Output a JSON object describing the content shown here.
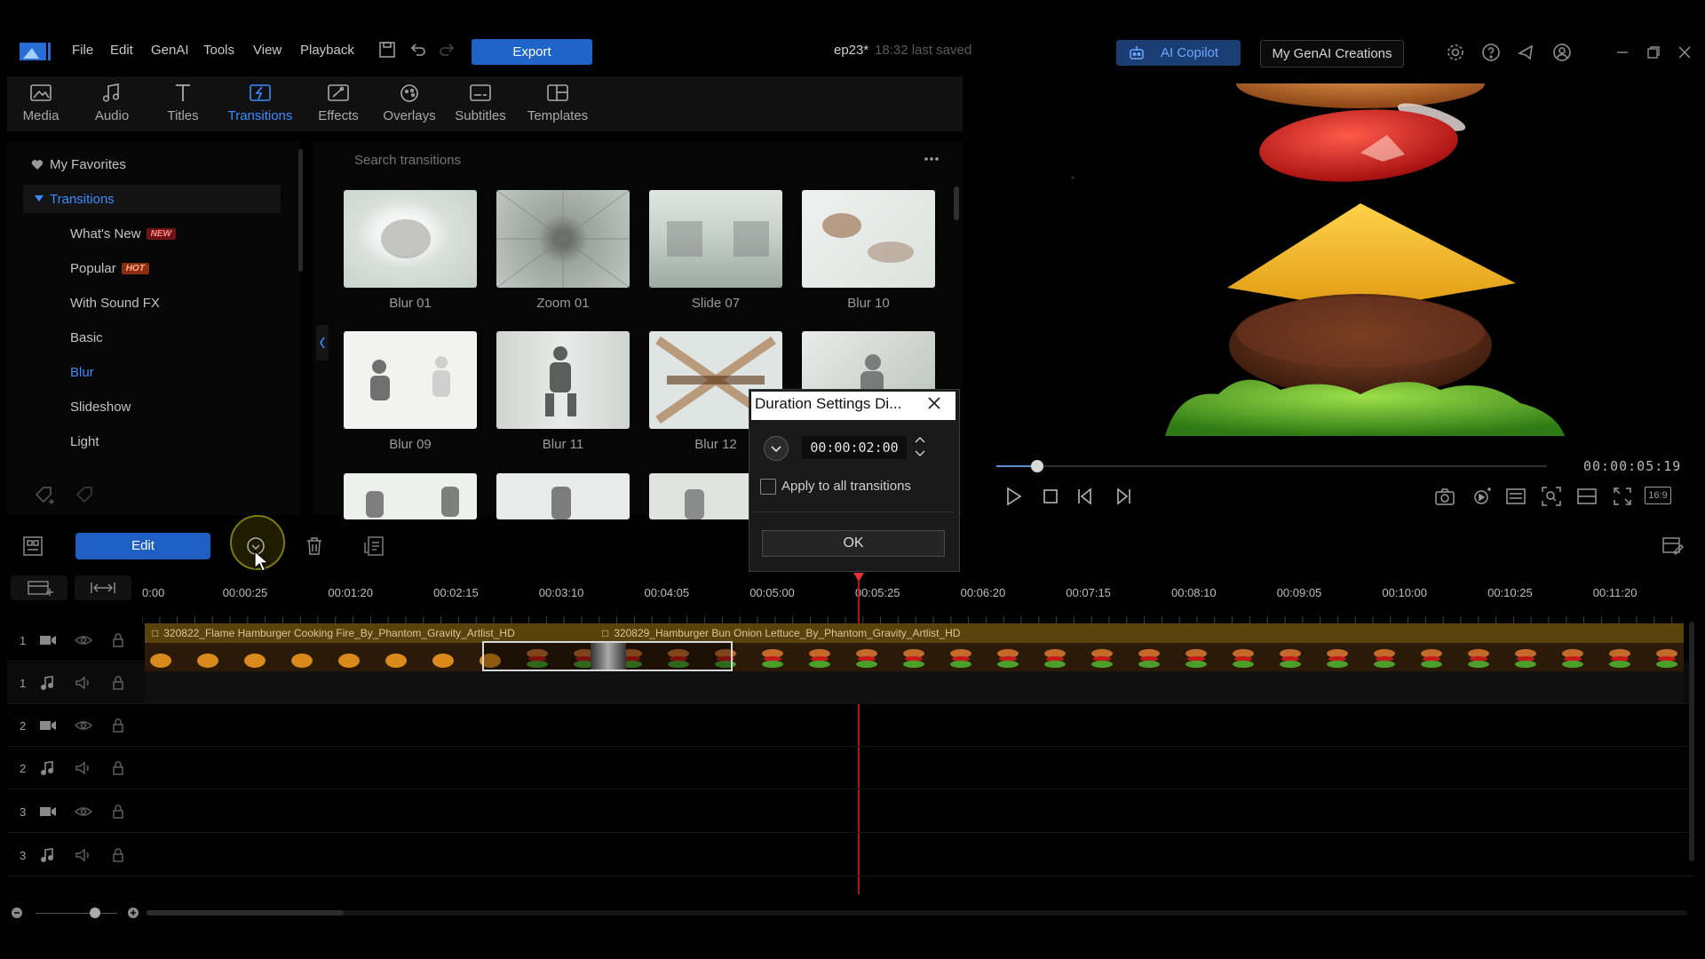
{
  "menu": {
    "items": [
      "File",
      "Edit",
      "GenAI",
      "Tools",
      "View",
      "Playback"
    ],
    "export_label": "Export",
    "project_title": "ep23*",
    "project_saved": "18:32 last saved",
    "ai_copilot_label": "AI Copilot",
    "my_genai_label": "My GenAI Creations"
  },
  "tabs": [
    {
      "label": "Media",
      "icon": "media-icon"
    },
    {
      "label": "Audio",
      "icon": "music-icon"
    },
    {
      "label": "Titles",
      "icon": "titles-icon"
    },
    {
      "label": "Transitions",
      "icon": "transitions-icon",
      "active": true
    },
    {
      "label": "Effects",
      "icon": "effects-icon"
    },
    {
      "label": "Overlays",
      "icon": "overlays-icon"
    },
    {
      "label": "Subtitles",
      "icon": "subtitles-icon"
    },
    {
      "label": "Templates",
      "icon": "templates-icon"
    }
  ],
  "sidebar": {
    "favorites": "My Favorites",
    "group": "Transitions",
    "items": [
      {
        "label": "What's New",
        "badge": "NEW"
      },
      {
        "label": "Popular",
        "badge": "HOT"
      },
      {
        "label": "With Sound FX"
      },
      {
        "label": "Basic"
      },
      {
        "label": "Blur",
        "selected": true
      },
      {
        "label": "Slideshow"
      },
      {
        "label": "Light"
      }
    ]
  },
  "library": {
    "search_placeholder": "Search transitions",
    "items": [
      {
        "label": "Blur 01"
      },
      {
        "label": "Zoom 01"
      },
      {
        "label": "Slide 07"
      },
      {
        "label": "Blur 10"
      },
      {
        "label": "Blur 09"
      },
      {
        "label": "Blur 11"
      },
      {
        "label": "Blur 12"
      },
      {
        "label": ""
      }
    ]
  },
  "preview": {
    "timecode": "00:00:05:19",
    "aspect": "16:9"
  },
  "timeline": {
    "edit_label": "Edit",
    "ruler": [
      "0:00",
      "00:00:25",
      "00:01:20",
      "00:02:15",
      "00:03:10",
      "00:04:05",
      "00:05:00",
      "00:05:25",
      "00:06:20",
      "00:07:15",
      "00:08:10",
      "00:09:05",
      "00:10:00",
      "00:10:25",
      "00:11:20"
    ],
    "tracks": [
      {
        "num": "1",
        "kind": "video"
      },
      {
        "num": "1",
        "kind": "audio"
      },
      {
        "num": "2",
        "kind": "video"
      },
      {
        "num": "2",
        "kind": "audio"
      },
      {
        "num": "3",
        "kind": "video"
      },
      {
        "num": "3",
        "kind": "audio"
      }
    ],
    "clips": [
      {
        "name": "320822_Flame Hamburger Cooking Fire_By_Phantom_Gravity_Artlist_HD"
      },
      {
        "name": "320829_Hamburger Bun Onion Lettuce_By_Phantom_Gravity_Artlist_HD"
      }
    ]
  },
  "dialog": {
    "title": "Duration Settings Di...",
    "duration": "00:00:02:00",
    "apply_all_label": "Apply to all transitions",
    "ok_label": "OK"
  },
  "colors": {
    "accent": "#1f64c8",
    "active_tab": "#3b8cff",
    "playhead": "#b3121b",
    "clip_bar": "#5a420c"
  }
}
